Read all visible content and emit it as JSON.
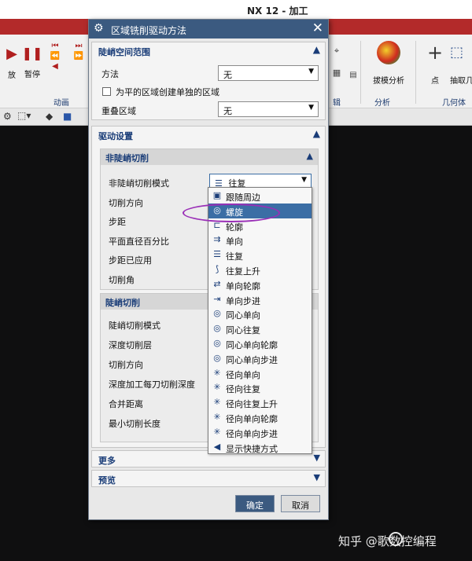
{
  "app": {
    "window_title": "NX 12 - 加工"
  },
  "ribbon": {
    "left_buttons": [
      {
        "label": "放"
      },
      {
        "label": "暂停"
      }
    ],
    "left_group": "动画",
    "right_group_labels": [
      "辑",
      "分析",
      "几何体"
    ],
    "right_buttons": [
      {
        "label": "拔模分析"
      },
      {
        "label": "点"
      },
      {
        "label": "抽取几"
      }
    ]
  },
  "dialog": {
    "title": "区域铣削驱动方法",
    "steep_section": {
      "title": "陡峭空间范围",
      "method_label": "方法",
      "method_value": "无",
      "checkbox_label": "为平的区域创建单独的区域",
      "overlap_label": "重叠区域",
      "overlap_value": "无"
    },
    "drive_section": {
      "title": "驱动设置",
      "nonsteep": {
        "title": "非陡峭切削",
        "rows": [
          {
            "label": "非陡峭切削模式",
            "value": "往复"
          },
          {
            "label": "切削方向"
          },
          {
            "label": "步距"
          },
          {
            "label": "平面直径百分比"
          },
          {
            "label": "步距已应用"
          },
          {
            "label": "切削角"
          }
        ]
      },
      "steep": {
        "title": "陡峭切削",
        "rows": [
          {
            "label": "陡峭切削模式"
          },
          {
            "label": "深度切削层"
          },
          {
            "label": "切削方向"
          },
          {
            "label": "深度加工每刀切削深度"
          },
          {
            "label": "合并距离"
          },
          {
            "label": "最小切削长度"
          }
        ]
      }
    },
    "more": "更多",
    "preview": "预览",
    "ok": "确定",
    "cancel": "取消"
  },
  "dropdown": {
    "selected_index": 1,
    "items": [
      {
        "label": "跟随周边",
        "icon": "follow-periphery-icon"
      },
      {
        "label": "螺旋",
        "icon": "spiral-icon"
      },
      {
        "label": "轮廓",
        "icon": "profile-icon"
      },
      {
        "label": "单向",
        "icon": "zig-icon"
      },
      {
        "label": "往复",
        "icon": "zigzag-icon"
      },
      {
        "label": "往复上升",
        "icon": "zigzag-lift-icon"
      },
      {
        "label": "单向轮廓",
        "icon": "zig-with-contour-icon"
      },
      {
        "label": "单向步进",
        "icon": "zig-with-stepover-icon"
      },
      {
        "label": "同心单向",
        "icon": "concentric-zig-icon"
      },
      {
        "label": "同心往复",
        "icon": "concentric-zigzag-icon"
      },
      {
        "label": "同心单向轮廓",
        "icon": "concentric-zig-contour-icon"
      },
      {
        "label": "同心单向步进",
        "icon": "concentric-zig-step-icon"
      },
      {
        "label": "径向单向",
        "icon": "radial-zig-icon"
      },
      {
        "label": "径向往复",
        "icon": "radial-zigzag-icon"
      },
      {
        "label": "径向往复上升",
        "icon": "radial-zigzag-lift-icon"
      },
      {
        "label": "径向单向轮廓",
        "icon": "radial-zig-contour-icon"
      },
      {
        "label": "径向单向步进",
        "icon": "radial-zig-step-icon"
      },
      {
        "label": "显示快捷方式",
        "icon": "show-shortcuts-icon"
      }
    ]
  },
  "watermark": {
    "text": "知乎 @歌数控编程"
  }
}
